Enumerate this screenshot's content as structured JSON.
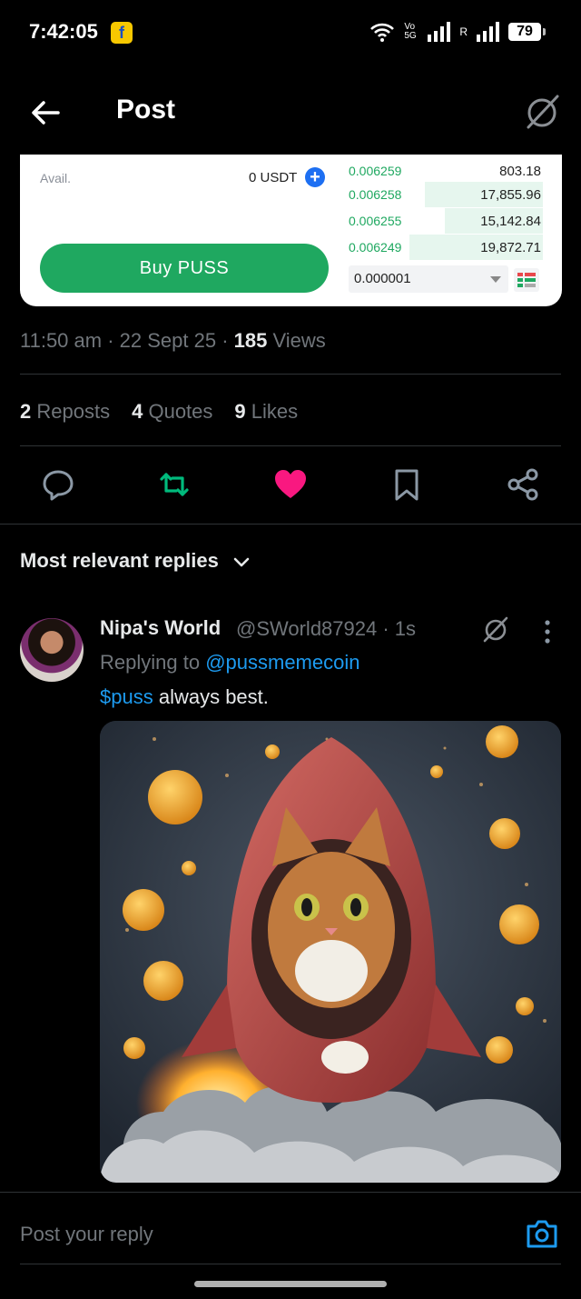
{
  "status_bar": {
    "time": "7:42:05",
    "network_label": "Vo 5G",
    "carrier_r": "R",
    "battery": "79"
  },
  "header": {
    "title": "Post"
  },
  "trade_card": {
    "avail_label": "Avail.",
    "avail_value": "0 USDT",
    "buy_button": "Buy  PUSS",
    "order_book": [
      {
        "price": "0.006259",
        "qty": "803.18",
        "depth": 0.0
      },
      {
        "price": "0.006258",
        "qty": "17,855.96",
        "depth": 0.6
      },
      {
        "price": "0.006255",
        "qty": "15,142.84",
        "depth": 0.5
      },
      {
        "price": "0.006249",
        "qty": "19,872.71",
        "depth": 0.68
      }
    ],
    "tick_size": "0.000001",
    "buy_color": "#1fa860",
    "accent_blue": "#1d6ff2"
  },
  "post_meta": {
    "time": "11:50 am",
    "date": "22 Sept 25",
    "views_count": "185",
    "views_label": "Views"
  },
  "stats": [
    {
      "count": "2",
      "label": "Reposts"
    },
    {
      "count": "4",
      "label": "Quotes"
    },
    {
      "count": "9",
      "label": "Likes"
    }
  ],
  "actions": {
    "reply_icon": "speech-bubble-icon",
    "repost_icon": "repost-icon",
    "like_icon": "heart-filled-icon",
    "bookmark_icon": "bookmark-icon",
    "share_icon": "share-icon",
    "repost_color": "#00ba7c",
    "like_color": "#f91880"
  },
  "replies": {
    "sort_label": "Most relevant replies",
    "items": [
      {
        "name": "Nipa's World",
        "handle": "@SWorld87924 · 1s",
        "replying_prefix": "Replying to ",
        "replying_handle": "@pussmemecoin",
        "cashtag": "$puss",
        "text": " always best."
      }
    ]
  },
  "compose": {
    "placeholder": "Post your reply"
  }
}
